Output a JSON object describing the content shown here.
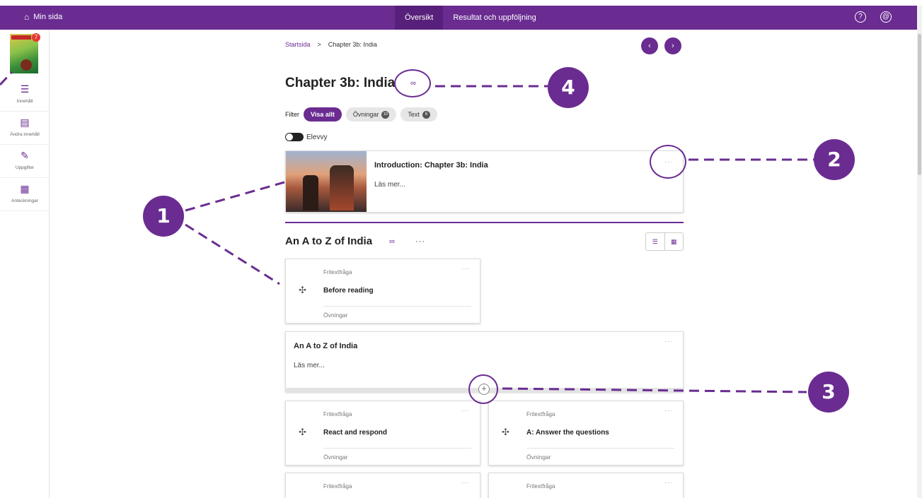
{
  "topbar": {
    "home_label": "Min sida",
    "tabs": [
      {
        "label": "Översikt",
        "active": true
      },
      {
        "label": "Resultat och uppföljning",
        "active": false
      }
    ],
    "help_icon": "?",
    "account_icon": "@"
  },
  "sidebar": {
    "book_badge": "7",
    "items": [
      {
        "label": "Innehåll",
        "icon": "list-icon"
      },
      {
        "label": "Ändra innehåll",
        "icon": "edit-content-icon"
      },
      {
        "label": "Uppgifter",
        "icon": "tasks-icon"
      },
      {
        "label": "Anteckningar",
        "icon": "notes-icon"
      }
    ]
  },
  "breadcrumb": {
    "home": "Startsida",
    "separator": ">",
    "current": "Chapter 3b: India"
  },
  "nav_arrows": {
    "prev": "‹",
    "next": "›"
  },
  "page_title": "Chapter 3b: India",
  "filter": {
    "label": "Filter",
    "chips": [
      {
        "label": "Visa allt",
        "count": "",
        "active": true
      },
      {
        "label": "Övningar",
        "count": "10",
        "active": false
      },
      {
        "label": "Text",
        "count": "6",
        "active": false
      }
    ]
  },
  "toggle": {
    "label": "Elevvy",
    "on": false
  },
  "intro_card": {
    "title": "Introduction: Chapter 3b: India",
    "more": "Läs mer..."
  },
  "section": {
    "title": "An A to Z of India"
  },
  "text_card": {
    "title": "An A to Z of India",
    "more": "Läs mer..."
  },
  "exercises": [
    {
      "type": "Fritextfråga",
      "name": "Before reading",
      "category": "Övningar"
    },
    {
      "type": "Fritextfråga",
      "name": "React and respond",
      "category": "Övningar"
    },
    {
      "type": "Fritextfråga",
      "name": "A: Answer the questions",
      "category": "Övningar"
    },
    {
      "type": "Fritextfråga",
      "name": "",
      "category": ""
    },
    {
      "type": "Fritextfråga",
      "name": "",
      "category": ""
    }
  ],
  "more_glyph": "···",
  "add_glyph": "+",
  "annotations": [
    "1",
    "2",
    "3",
    "4"
  ],
  "colors": {
    "brand": "#6a2c91",
    "brand_dark": "#57207a"
  }
}
